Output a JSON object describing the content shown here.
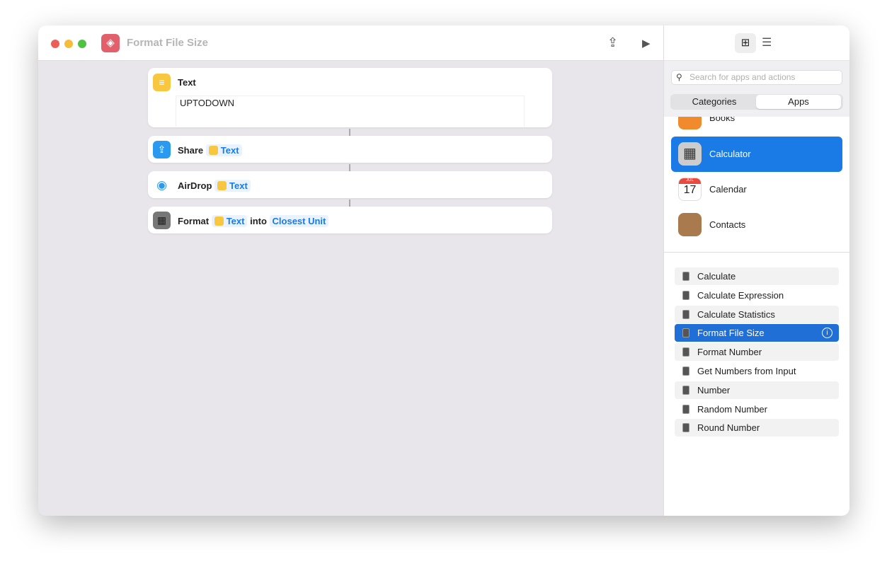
{
  "window": {
    "title": "Format File Size"
  },
  "toolbar": {
    "share_icon": "share-icon",
    "run_icon": "play-icon"
  },
  "workflow": {
    "text_action": {
      "label": "Text",
      "value": "UPTODOWN"
    },
    "share_action": {
      "label": "Share",
      "token": "Text"
    },
    "airdrop_action": {
      "label": "AirDrop",
      "token": "Text"
    },
    "format_action": {
      "label": "Format",
      "token": "Text",
      "into": "into",
      "unit": "Closest Unit"
    }
  },
  "sidebar": {
    "search_placeholder": "Search for apps and actions",
    "segments": [
      "Categories",
      "Apps"
    ],
    "apps": [
      {
        "name": "Books"
      },
      {
        "name": "Calculator"
      },
      {
        "name": "Calendar",
        "month": "JUL",
        "day": "17"
      },
      {
        "name": "Contacts"
      }
    ],
    "actions": [
      "Calculate",
      "Calculate Expression",
      "Calculate Statistics",
      "Format File Size",
      "Format Number",
      "Get Numbers from Input",
      "Number",
      "Random Number",
      "Round Number"
    ],
    "selected_action": "Format File Size"
  },
  "colors": {
    "accent": "#1a7ae6",
    "selected": "#1f6fd6"
  }
}
